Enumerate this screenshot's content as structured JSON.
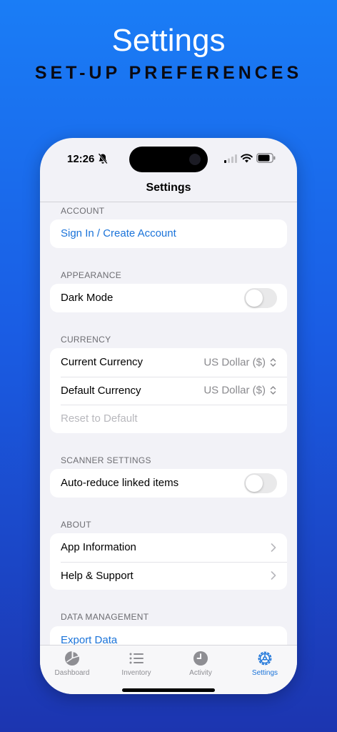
{
  "promo": {
    "title": "Settings",
    "subtitle": "SET-UP PREFERENCES"
  },
  "status_bar": {
    "time": "12:26",
    "icons": [
      "bell-slash-icon",
      "cellular-signal-icon",
      "wifi-icon",
      "battery-icon"
    ]
  },
  "nav": {
    "title": "Settings"
  },
  "sections": {
    "account": {
      "header": "ACCOUNT",
      "sign_in_label": "Sign In / Create Account"
    },
    "appearance": {
      "header": "APPEARANCE",
      "dark_mode_label": "Dark Mode",
      "dark_mode_on": false
    },
    "currency": {
      "header": "CURRENCY",
      "current_label": "Current Currency",
      "current_value": "US Dollar ($)",
      "default_label": "Default Currency",
      "default_value": "US Dollar ($)",
      "reset_label": "Reset to Default"
    },
    "scanner": {
      "header": "SCANNER SETTINGS",
      "auto_reduce_label": "Auto-reduce linked items",
      "auto_reduce_on": false
    },
    "about": {
      "header": "ABOUT",
      "app_info_label": "App Information",
      "help_label": "Help & Support"
    },
    "data_management": {
      "header": "DATA MANAGEMENT",
      "export_label": "Export Data"
    }
  },
  "tabs": [
    {
      "label": "Dashboard",
      "icon": "pie-chart-icon",
      "active": false
    },
    {
      "label": "Inventory",
      "icon": "list-icon",
      "active": false
    },
    {
      "label": "Activity",
      "icon": "clock-icon",
      "active": false
    },
    {
      "label": "Settings",
      "icon": "gear-icon",
      "active": true
    }
  ],
  "colors": {
    "accent": "#1a73d9",
    "background_top": "#1a7df6",
    "background_bottom": "#1c35b0",
    "grouped_background": "#f2f2f7"
  }
}
